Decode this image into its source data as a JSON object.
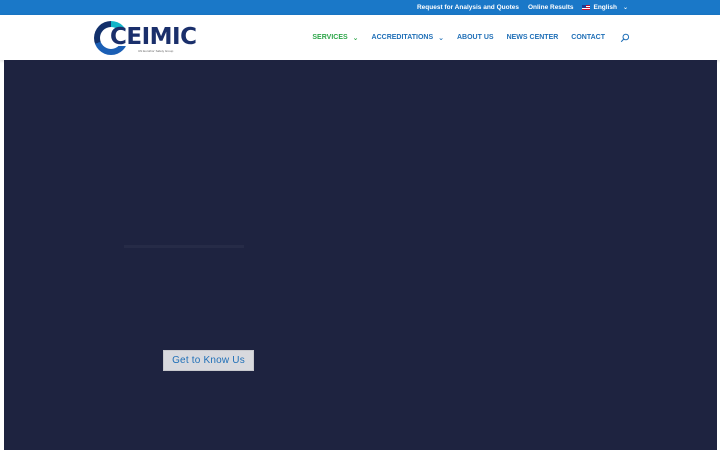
{
  "topbar": {
    "request_link": "Request for Analysis and Quotes",
    "results_link": "Online Results",
    "language": "English",
    "language_flag_icon": "us-flag-icon",
    "accent_color": "#1a78c8"
  },
  "brand": {
    "name": "CEIMIC",
    "tagline": "UN Eurofins' Safety Group"
  },
  "nav": {
    "items": [
      {
        "label": "SERVICES",
        "has_dropdown": true,
        "active": true
      },
      {
        "label": "ACCREDITATIONS",
        "has_dropdown": true,
        "active": false
      },
      {
        "label": "ABOUT US",
        "has_dropdown": false,
        "active": false
      },
      {
        "label": "NEWS CENTER",
        "has_dropdown": false,
        "active": false
      },
      {
        "label": "CONTACT",
        "has_dropdown": false,
        "active": false
      }
    ],
    "search_icon": "search-icon",
    "active_color": "#2ea64a",
    "link_color": "#1f6fb7"
  },
  "hero": {
    "background_color": "#1e2340",
    "cta_label": "Get to Know Us"
  }
}
